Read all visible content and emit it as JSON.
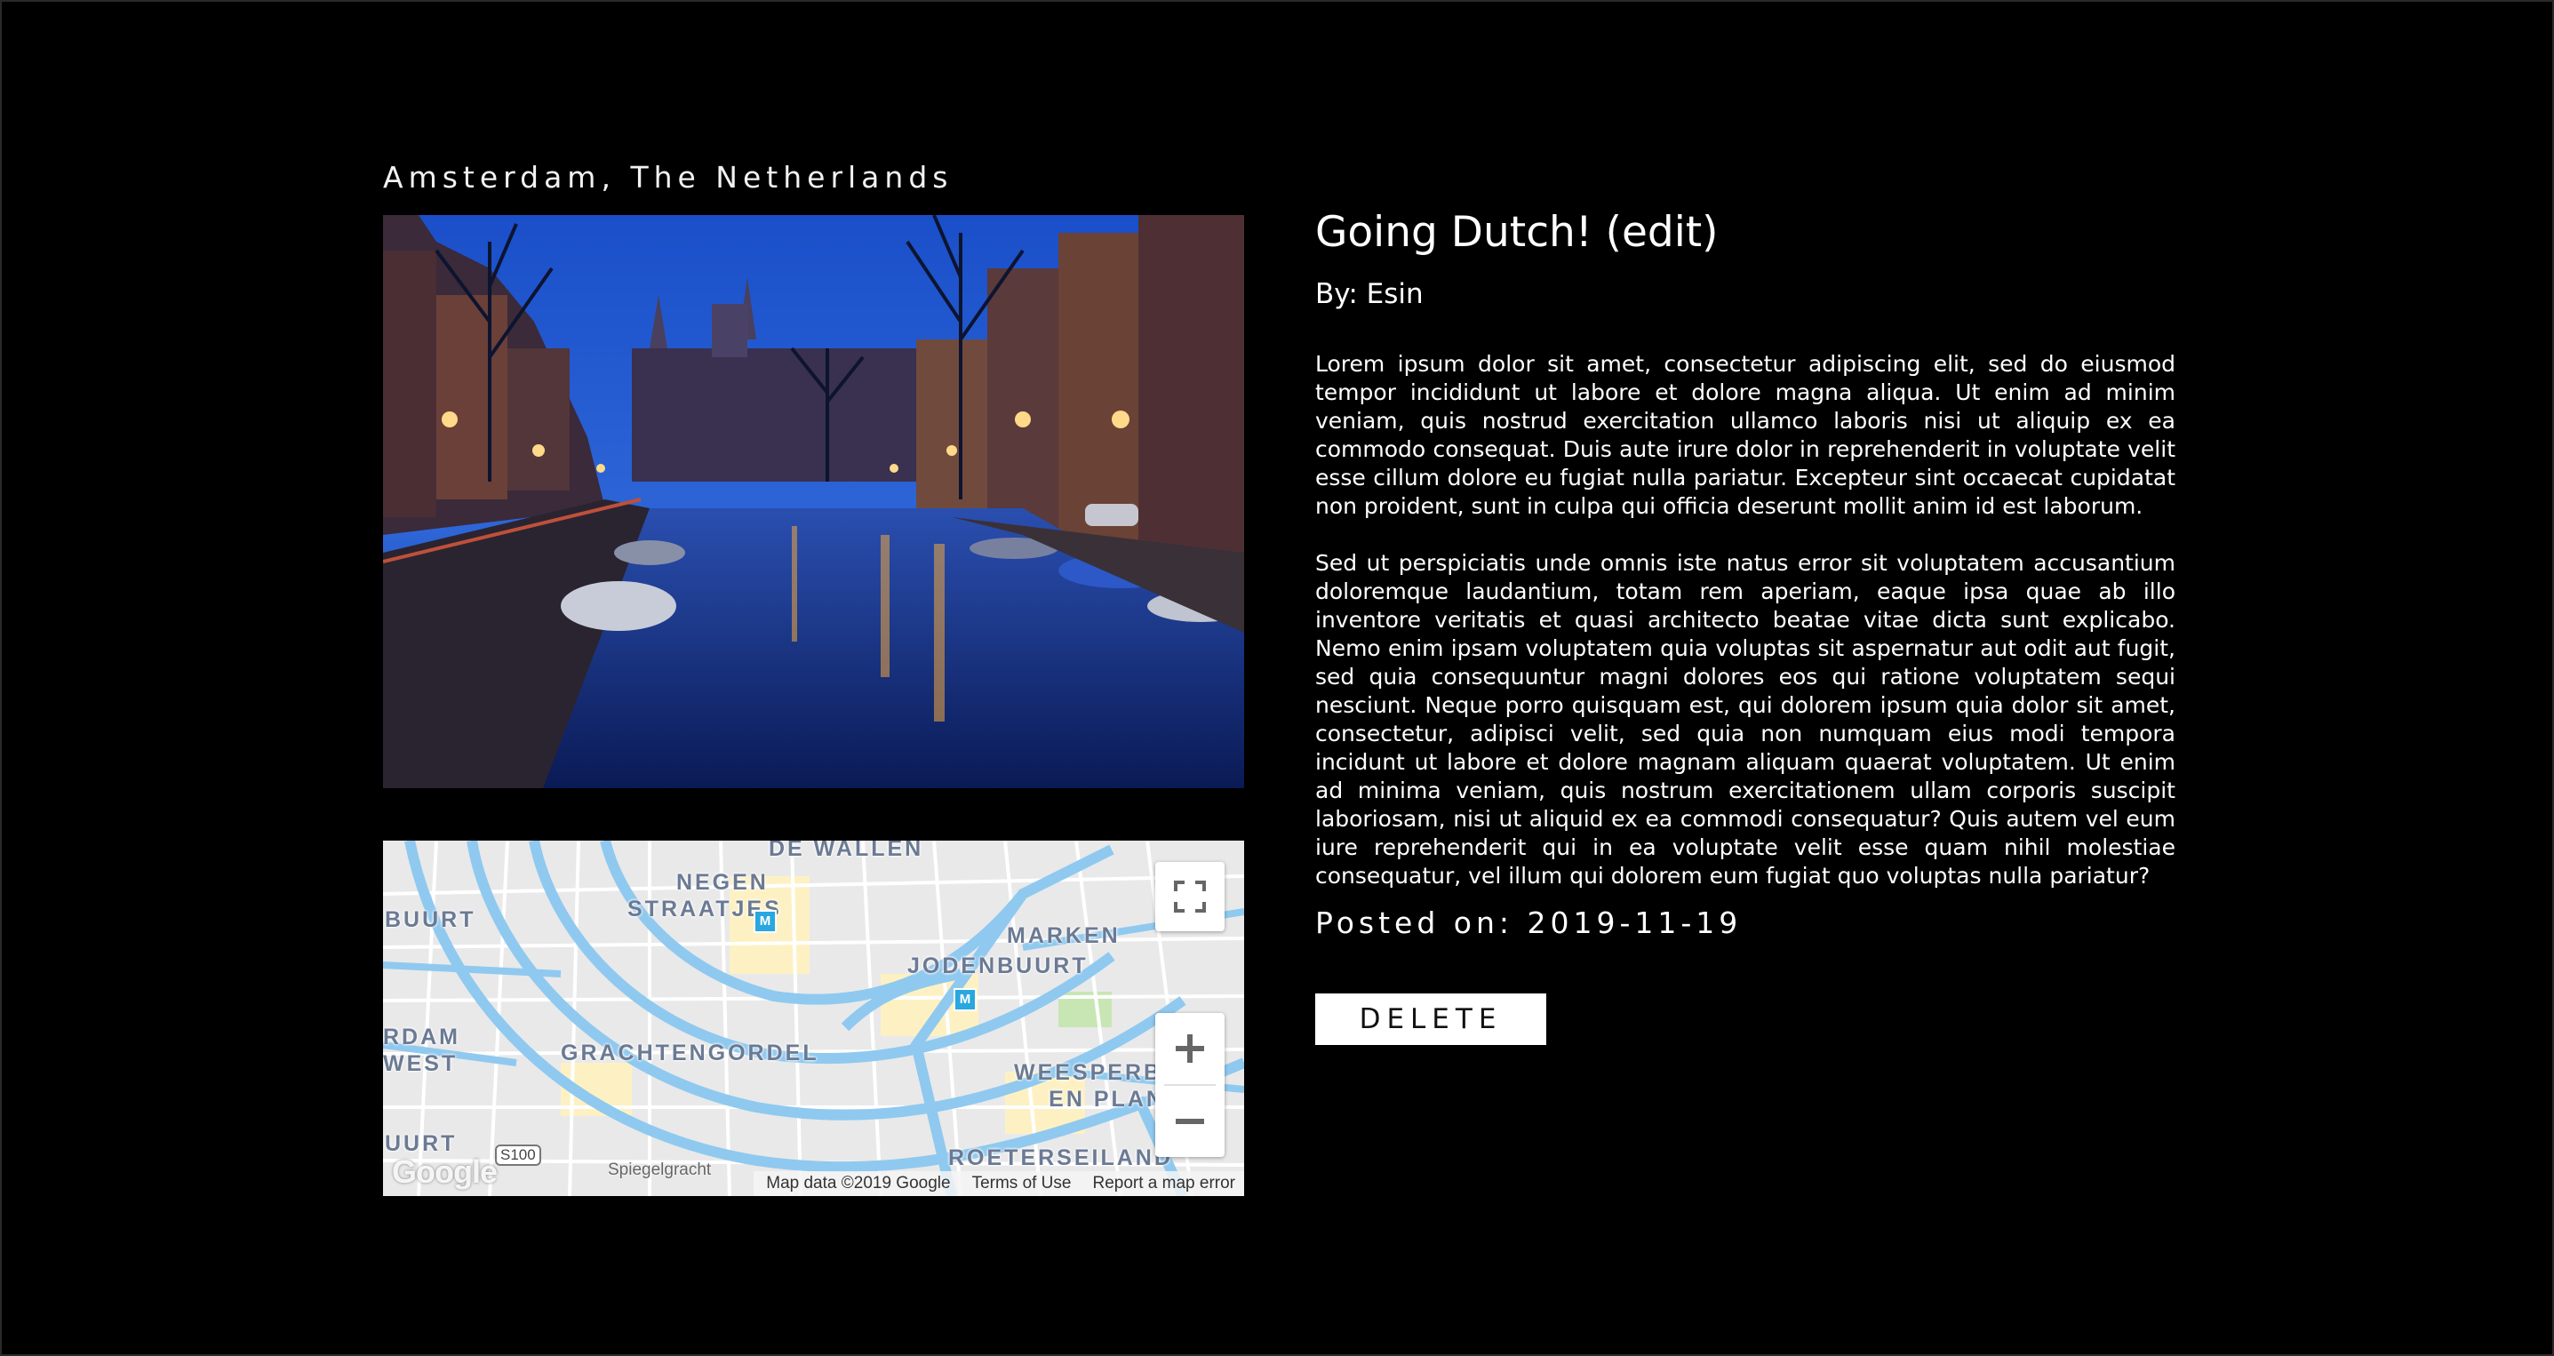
{
  "post": {
    "location": "Amsterdam, The Netherlands",
    "title": "Going Dutch! (edit)",
    "author": "By: Esin",
    "paragraphs": [
      "Lorem ipsum dolor sit amet, consectetur adipiscing elit, sed do eiusmod tempor incididunt ut labore et dolore magna aliqua. Ut enim ad minim veniam, quis nostrud exercitation ullamco laboris nisi ut aliquip ex ea commodo consequat. Duis aute irure dolor in reprehenderit in voluptate velit esse cillum dolore eu fugiat nulla pariatur. Excepteur sint occaecat cupidatat non proident, sunt in culpa qui officia deserunt mollit anim id est laborum.",
      "Sed ut perspiciatis unde omnis iste natus error sit voluptatem accusantium doloremque laudantium, totam rem aperiam, eaque ipsa quae ab illo inventore veritatis et quasi architecto beatae vitae dicta sunt explicabo. Nemo enim ipsam voluptatem quia voluptas sit aspernatur aut odit aut fugit, sed quia consequuntur magni dolores eos qui ratione voluptatem sequi nesciunt. Neque porro quisquam est, qui dolorem ipsum quia dolor sit amet, consectetur, adipisci velit, sed quia non numquam eius modi tempora incidunt ut labore et dolore magnam aliquam quaerat voluptatem. Ut enim ad minima veniam, quis nostrum exercitationem ullam corporis suscipit laboriosam, nisi ut aliquid ex ea commodi consequatur? Quis autem vel eum iure reprehenderit qui in ea voluptate velit esse quam nihil molestiae consequatur, vel illum qui dolorem eum fugiat quo voluptas nulla pariatur?"
    ],
    "posted": "Posted on: 2019-11-19",
    "delete_label": "DELETE"
  },
  "map": {
    "labels": {
      "de_wallen": "DE WALLEN",
      "negen_line1": "NEGEN",
      "negen_line2": "STRAATJES",
      "buurt_top": "BUURT",
      "marken": "MARKEN",
      "jodenbuurt": "JODENBUURT",
      "west_line1": "RDAM",
      "west_line2": "WEST",
      "grachtengordel": "GRACHTENGORDEL",
      "weesper_line1": "WEESPERBU",
      "weesper_line2": "EN PLANT",
      "buurt_bottom": "UURT",
      "roeterseiland": "ROETERSEILAND",
      "spiegelgracht": "Spiegelgracht",
      "route": "S100",
      "metro": "M"
    },
    "logo": "Google",
    "footer": {
      "data": "Map data ©2019 Google",
      "terms": "Terms of Use",
      "report": "Report a map error"
    }
  },
  "icons": {
    "fullscreen": "fullscreen-icon",
    "zoom_in": "plus-icon",
    "zoom_out": "minus-icon"
  },
  "colors": {
    "background": "#000000",
    "text": "#ffffff",
    "button_bg": "#ffffff",
    "button_text": "#111111",
    "map_water": "#8fc9ef",
    "map_land": "#e8e8e8"
  }
}
